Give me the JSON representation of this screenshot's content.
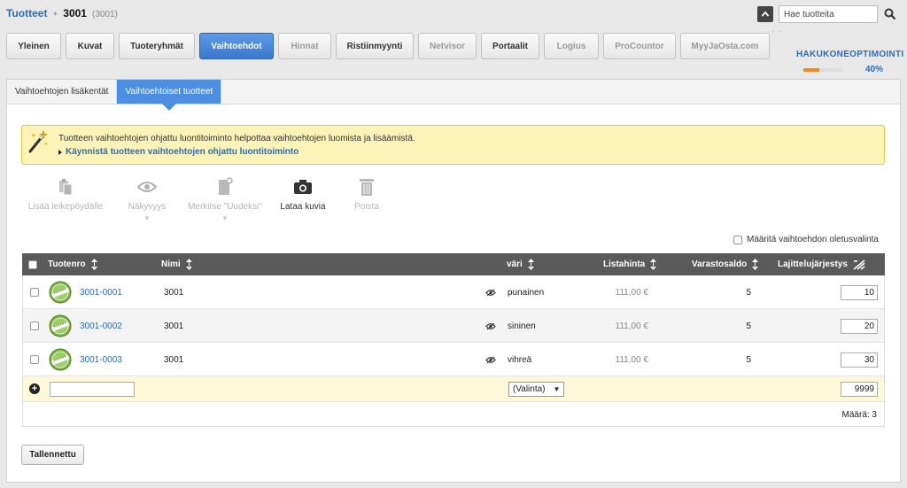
{
  "breadcrumb": {
    "root": "Tuotteet",
    "separator": "+",
    "current": "3001",
    "sub": "(3001)"
  },
  "search": {
    "placeholder": "Hae tuotteita"
  },
  "main_tabs": [
    {
      "label": "Yleinen",
      "state": "normal"
    },
    {
      "label": "Kuvat",
      "state": "normal"
    },
    {
      "label": "Tuoteryhmät",
      "state": "normal"
    },
    {
      "label": "Vaihtoehdot",
      "state": "active"
    },
    {
      "label": "Hinnat",
      "state": "disabled"
    },
    {
      "label": "Ristiinmyynti",
      "state": "normal"
    },
    {
      "label": "Netvisor",
      "state": "disabled"
    },
    {
      "label": "Portaalit",
      "state": "normal"
    },
    {
      "label": "Logius",
      "state": "disabled"
    },
    {
      "label": "ProCountor",
      "state": "disabled"
    },
    {
      "label": "MyyJaOsta.com",
      "state": "disabled"
    }
  ],
  "seo": {
    "title": "HAKUKONEOPTIMOINTI",
    "percent_label": "40%",
    "fraction": 0.4
  },
  "sub_tabs": [
    {
      "label": "Vaihtoehtojen lisäkentät"
    },
    {
      "label": "Vaihtoehtoiset tuotteet"
    }
  ],
  "notice": {
    "message": "Tuotteen vaihtoehtojen ohjattu luontitoiminto helpottaa vaihtoehtojen luomista ja lisäämistä.",
    "link": "Käynnistä tuotteen vaihtoehtojen ohjattu luontitoiminto"
  },
  "toolbar": {
    "copy": "Lisää leikepöydälle",
    "visibility": "Näkyvyys",
    "mark_new": "Merkitse \"Uudeksi\"",
    "upload": "Lataa kuvia",
    "delete": "Poista",
    "caret": "▼"
  },
  "default_option_label": "Määritä vaihtoehdon oletusvalinta",
  "table": {
    "headers": {
      "code": "Tuotenro",
      "name": "Nimi",
      "color": "väri",
      "price": "Listahinta",
      "stock": "Varastosaldo",
      "order": "Lajittelujärjestys"
    },
    "rows": [
      {
        "code": "3001-0001",
        "name": "3001",
        "color": "punainen",
        "price": "111,00 €",
        "stock": "5",
        "order": "10"
      },
      {
        "code": "3001-0002",
        "name": "3001",
        "color": "sininen",
        "price": "111,00 €",
        "stock": "5",
        "order": "20"
      },
      {
        "code": "3001-0003",
        "name": "3001",
        "color": "vihreä",
        "price": "111,00 €",
        "stock": "5",
        "order": "30"
      }
    ],
    "add_row": {
      "select_value": "(Valinta)",
      "select_caret": "▼",
      "order": "9999"
    },
    "count_label": "Määrä: 3"
  },
  "save_button": "Tallennettu",
  "colors": {
    "accent": "#2a6ebb",
    "active_tab": "#4c8fe0",
    "notice_bg": "#fbf3b7",
    "header_bg": "#5a5a5a"
  }
}
